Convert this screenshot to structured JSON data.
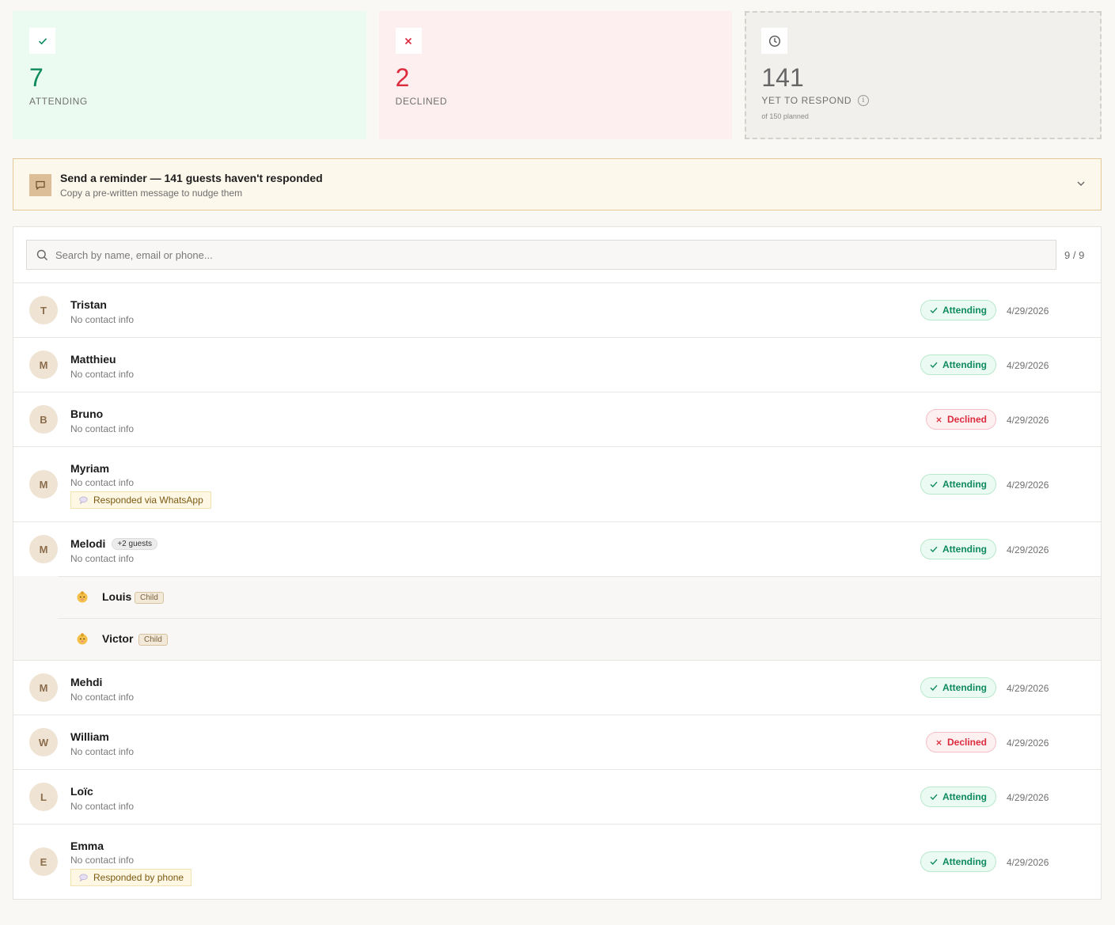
{
  "stats": {
    "attending": {
      "count": "7",
      "label": "ATTENDING",
      "color": "#0e8a5e",
      "icon": "check-icon"
    },
    "declined": {
      "count": "2",
      "label": "DECLINED",
      "color": "#dc2b3d",
      "icon": "x-icon"
    },
    "pending": {
      "count": "141",
      "label": "YET TO RESPOND",
      "sub": "of 150 planned",
      "icon": "clock-icon"
    }
  },
  "reminder": {
    "title": "Send a reminder — 141 guests haven't responded",
    "subtitle": "Copy a pre-written message to nudge them",
    "icon": "message-icon"
  },
  "search": {
    "placeholder": "Search by name, email or phone...",
    "value": "",
    "count": "9 / 9"
  },
  "guests": [
    {
      "initial": "T",
      "name": "Tristan",
      "contact": "No contact info",
      "status": "Attending",
      "date": "4/29/2026"
    },
    {
      "initial": "M",
      "name": "Matthieu",
      "contact": "No contact info",
      "status": "Attending",
      "date": "4/29/2026"
    },
    {
      "initial": "B",
      "name": "Bruno",
      "contact": "No contact info",
      "status": "Declined",
      "date": "4/29/2026"
    },
    {
      "initial": "M",
      "name": "Myriam",
      "contact": "No contact info",
      "via": "Responded via WhatsApp",
      "status": "Attending",
      "date": "4/29/2026"
    },
    {
      "initial": "M",
      "name": "Melodi",
      "badge": "+2 guests",
      "contact": "No contact info",
      "status": "Attending",
      "date": "4/29/2026",
      "companions": [
        {
          "name": "Louis",
          "tag": "Child"
        },
        {
          "name": "Victor",
          "tag": "Child"
        }
      ]
    },
    {
      "initial": "M",
      "name": "Mehdi",
      "contact": "No contact info",
      "status": "Attending",
      "date": "4/29/2026"
    },
    {
      "initial": "W",
      "name": "William",
      "contact": "No contact info",
      "status": "Declined",
      "date": "4/29/2026"
    },
    {
      "initial": "L",
      "name": "Loïc",
      "contact": "No contact info",
      "status": "Attending",
      "date": "4/29/2026"
    },
    {
      "initial": "E",
      "name": "Emma",
      "contact": "No contact info",
      "via": "Responded by phone",
      "status": "Attending",
      "date": "4/29/2026"
    }
  ]
}
